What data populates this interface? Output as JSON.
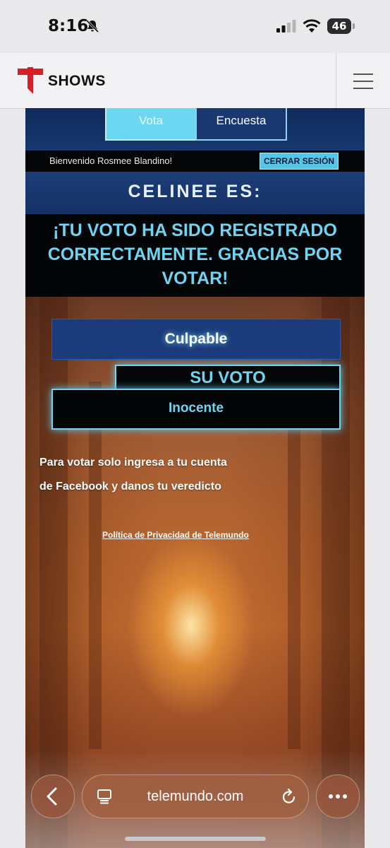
{
  "status_bar": {
    "time": "8:16",
    "battery": "46"
  },
  "header": {
    "brand": "SHOWS"
  },
  "tabs": [
    {
      "label": "Vota"
    },
    {
      "label": "Encuesta"
    }
  ],
  "session": {
    "welcome": "Bienvenido Rosmee Blandino!",
    "logout_label": "CERRAR SESIÓN"
  },
  "poll": {
    "heading": "CELINEE ES:",
    "confirmation": "¡TU VOTO HA SIDO REGISTRADO CORRECTAMENTE. GRACIAS POR VOTAR!",
    "options": [
      {
        "label": "Culpable"
      },
      {
        "label": "Inocente"
      }
    ],
    "your_vote_label": "SU VOTO",
    "info_line1": "Para votar solo ingresa a tu cuenta",
    "info_line2": "de Facebook y danos tu veredicto",
    "privacy_link": "Política de Privacidad de Telemundo"
  },
  "browser": {
    "url": "telemundo.com"
  },
  "colors": {
    "accent_cyan": "#6fd3f2",
    "navy": "#1b3b7a",
    "brand_red": "#d61f26"
  },
  "icons": [
    "bell-slash-icon",
    "signal-icon",
    "wifi-icon",
    "battery-icon",
    "telemundo-logo",
    "hamburger-icon",
    "back-chevron-icon",
    "tabs-icon",
    "reload-icon",
    "more-icon"
  ]
}
